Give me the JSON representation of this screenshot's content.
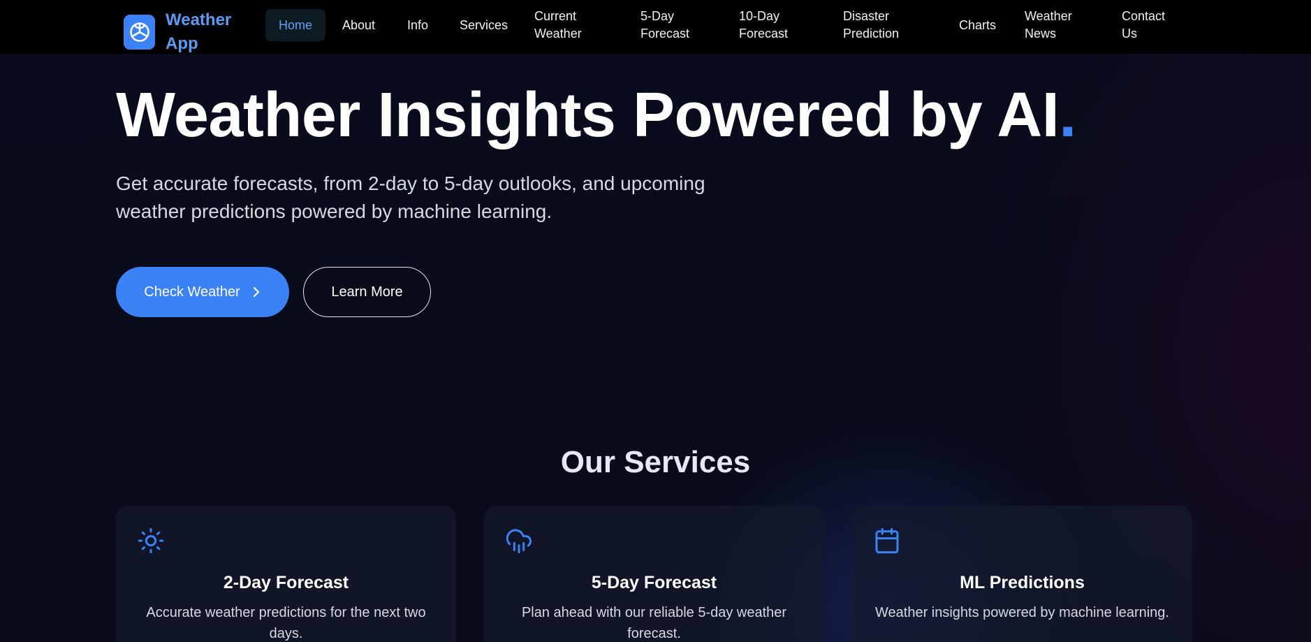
{
  "nav": {
    "brand": "Weather App",
    "items": [
      {
        "label": "Home",
        "active": true
      },
      {
        "label": "About"
      },
      {
        "label": "Info"
      },
      {
        "label": "Services"
      },
      {
        "label": "Current Weather"
      },
      {
        "label": "5-Day Forecast"
      },
      {
        "label": "10-Day Forecast"
      },
      {
        "label": "Disaster Prediction"
      },
      {
        "label": "Charts"
      },
      {
        "label": "Weather News"
      },
      {
        "label": "Contact Us"
      }
    ]
  },
  "hero": {
    "title": "Weather Insights Powered by AI",
    "title_dot": ".",
    "subtitle": "Get accurate forecasts, from 2-day to 5-day outlooks, and upcoming weather predictions powered by machine learning.",
    "primary_button": "Check Weather",
    "secondary_button": "Learn More"
  },
  "services": {
    "heading": "Our Services",
    "cards": [
      {
        "icon": "sun-icon",
        "title": "2-Day Forecast",
        "description": "Accurate weather predictions for the next two days."
      },
      {
        "icon": "cloud-rain-icon",
        "title": "5-Day Forecast",
        "description": "Plan ahead with our reliable 5-day weather forecast."
      },
      {
        "icon": "calendar-icon",
        "title": "ML Predictions",
        "description": "Weather insights powered by machine learning."
      }
    ]
  },
  "colors": {
    "accent": "#3b82f6",
    "nav_bg": "#000000",
    "page_bg": "#080c1c"
  }
}
